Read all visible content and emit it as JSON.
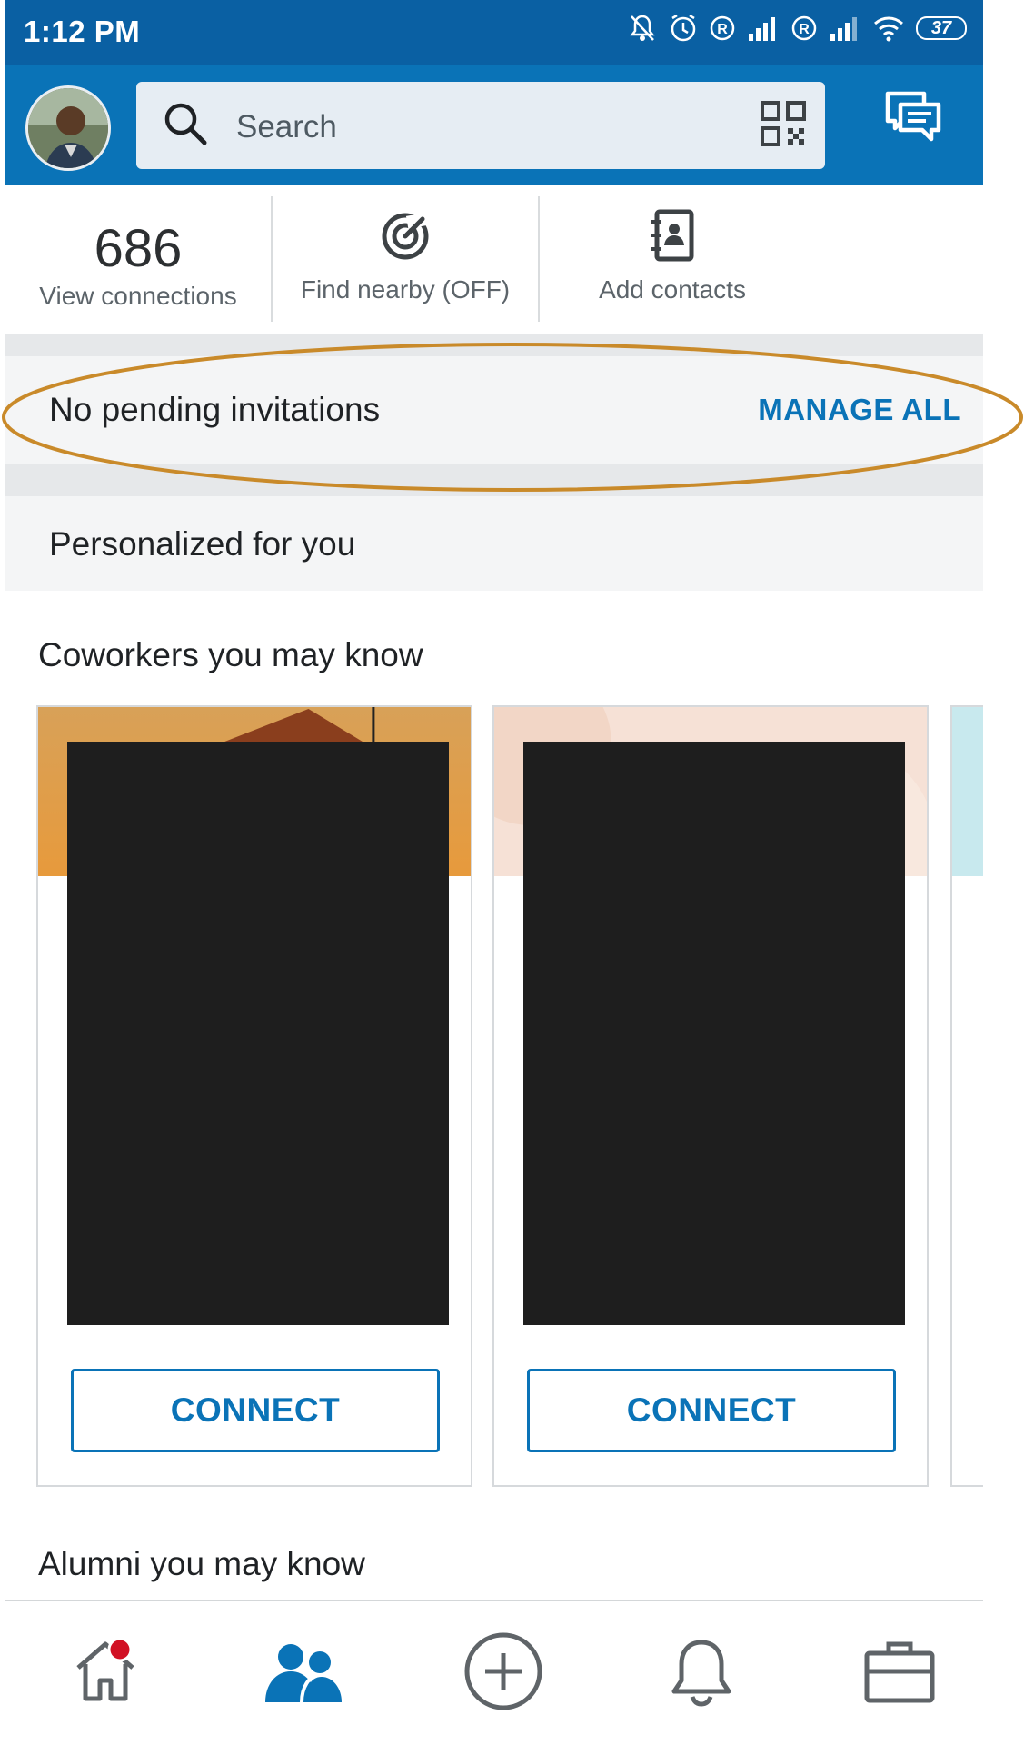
{
  "status_bar": {
    "time": "1:12 PM",
    "battery": "37"
  },
  "search": {
    "placeholder": "Search"
  },
  "quick_actions": {
    "connections_count": "686",
    "connections_label": "View connections",
    "find_nearby_label": "Find nearby (OFF)",
    "add_contacts_label": "Add contacts"
  },
  "invitations": {
    "text": "No pending invitations",
    "manage_label": "MANAGE ALL"
  },
  "personalized": {
    "title": "Personalized for you"
  },
  "sections": {
    "coworkers_title": "Coworkers you may know",
    "alumni_title": "Alumni you may know"
  },
  "cards": [
    {
      "connect_label": "CONNECT"
    },
    {
      "connect_label": "CONNECT"
    }
  ],
  "nav": {
    "items": [
      "home-icon",
      "my-network-icon",
      "post-icon",
      "notifications-icon",
      "jobs-icon"
    ],
    "active": "my-network-icon"
  },
  "colors": {
    "status_bar": "#0a60a3",
    "app_bar": "#0a73b7",
    "accent": "#0a73b7",
    "annotation_oval": "#c98a2a",
    "notification_dot": "#d11124"
  }
}
